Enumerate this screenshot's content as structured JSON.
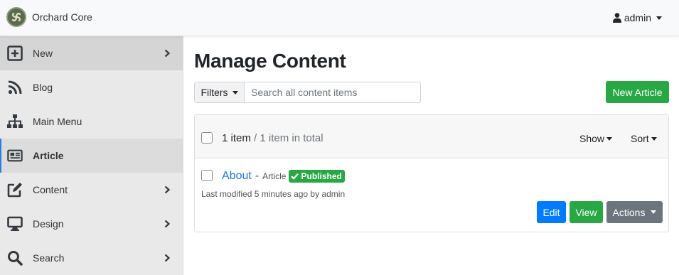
{
  "brand": {
    "name": "Orchard Core"
  },
  "user": {
    "name": "admin"
  },
  "sidebar": {
    "items": [
      {
        "label": "New",
        "icon": "plus-square-icon",
        "has_submenu": true,
        "state": "hover"
      },
      {
        "label": "Blog",
        "icon": "rss-icon",
        "has_submenu": false,
        "state": ""
      },
      {
        "label": "Main Menu",
        "icon": "sitemap-icon",
        "has_submenu": false,
        "state": ""
      },
      {
        "label": "Article",
        "icon": "newspaper-icon",
        "has_submenu": false,
        "state": "active"
      },
      {
        "label": "Content",
        "icon": "edit-icon",
        "has_submenu": true,
        "state": ""
      },
      {
        "label": "Design",
        "icon": "desktop-icon",
        "has_submenu": true,
        "state": ""
      },
      {
        "label": "Search",
        "icon": "search-icon",
        "has_submenu": true,
        "state": ""
      }
    ]
  },
  "main": {
    "title": "Manage Content",
    "filters_label": "Filters",
    "search_placeholder": "Search all content items",
    "new_button": "New Article",
    "list": {
      "count_label": "1 item",
      "total_label": "/ 1 item in total",
      "show_label": "Show",
      "sort_label": "Sort",
      "items": [
        {
          "title": "About",
          "separator": "-",
          "type": "Article",
          "status": "Published",
          "modified": "Last modified 5 minutes ago by admin",
          "edit_label": "Edit",
          "view_label": "View",
          "actions_label": "Actions"
        }
      ]
    }
  },
  "colors": {
    "primary": "#007bff",
    "success": "#28a745",
    "secondary": "#6c757d",
    "link": "#1b73e8",
    "sidebar_bg": "#e9e9e9",
    "active_indicator": "#2c7be5"
  }
}
